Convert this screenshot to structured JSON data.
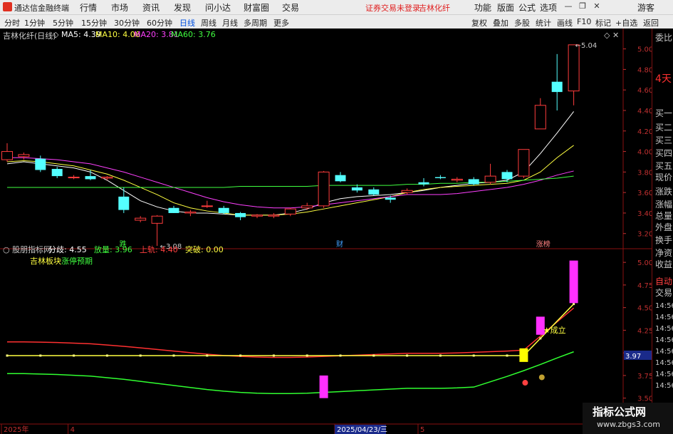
{
  "app": {
    "title": "通达信金融终端",
    "menus": [
      "行情",
      "市场",
      "资讯",
      "发现",
      "问小达",
      "财富圈",
      "交易"
    ],
    "notice": "证券交易未登录",
    "stock_link": "吉林化纤",
    "right_menus": [
      "功能",
      "版面",
      "公式",
      "选项"
    ],
    "user": "游客",
    "window_buttons": [
      "—",
      "❐",
      "✕"
    ]
  },
  "toolbar": {
    "periods": [
      "分时",
      "1分钟",
      "5分钟",
      "15分钟",
      "30分钟",
      "60分钟",
      "日线",
      "周线",
      "月线",
      "多周期",
      "更多"
    ],
    "active_period": "日线",
    "tools": [
      "复权",
      "叠加",
      "多股",
      "统计",
      "画线",
      "F10",
      "标记",
      "+自选",
      "返回"
    ]
  },
  "main_info": {
    "stock": "吉林化纤(日线)",
    "ma": [
      {
        "label": "MA5: 4.39",
        "color": "#ffffff"
      },
      {
        "label": "MA10: 4.06",
        "color": "#ffff40"
      },
      {
        "label": "MA20: 3.81",
        "color": "#ff40ff"
      },
      {
        "label": "MA60: 3.76",
        "color": "#40ff40"
      }
    ]
  },
  "side_panel": {
    "items": [
      "委比",
      "4天",
      "买一",
      "买二",
      "买三",
      "买四",
      "买五",
      "现价",
      "涨跌",
      "涨幅",
      "总量",
      "外盘",
      "换手",
      "净资",
      "收益",
      "自动",
      "交易",
      "14:56",
      "14:56",
      "14:56",
      "14:56",
      "14:56",
      "14:56",
      "14:56",
      "14:56"
    ],
    "tag": "0\nR\n1000"
  },
  "chart_data": {
    "type": "candlestick",
    "price_axis": {
      "ticks": [
        "5.00",
        "4.80",
        "4.60",
        "4.40",
        "4.20",
        "4.00",
        "3.80",
        "3.60",
        "3.40",
        "3.20"
      ],
      "range": [
        3.08,
        5.06
      ]
    },
    "candles": [
      {
        "o": 3.92,
        "h": 4.08,
        "l": 3.9,
        "c": 4.0
      },
      {
        "o": 3.95,
        "h": 3.99,
        "l": 3.92,
        "c": 3.97
      },
      {
        "o": 3.93,
        "h": 3.96,
        "l": 3.8,
        "c": 3.82
      },
      {
        "o": 3.83,
        "h": 3.85,
        "l": 3.74,
        "c": 3.76
      },
      {
        "o": 3.75,
        "h": 3.77,
        "l": 3.73,
        "c": 3.75
      },
      {
        "o": 3.76,
        "h": 3.82,
        "l": 3.72,
        "c": 3.73
      },
      {
        "o": 3.74,
        "h": 3.76,
        "l": 3.72,
        "c": 3.75
      },
      {
        "o": 3.56,
        "h": 3.65,
        "l": 3.4,
        "c": 3.43
      },
      {
        "o": 3.33,
        "h": 3.37,
        "l": 3.31,
        "c": 3.35
      },
      {
        "o": 3.3,
        "h": 3.38,
        "l": 3.08,
        "c": 3.37
      },
      {
        "o": 3.45,
        "h": 3.47,
        "l": 3.4,
        "c": 3.4
      },
      {
        "o": 3.4,
        "h": 3.43,
        "l": 3.37,
        "c": 3.41
      },
      {
        "o": 3.47,
        "h": 3.52,
        "l": 3.45,
        "c": 3.47
      },
      {
        "o": 3.45,
        "h": 3.47,
        "l": 3.39,
        "c": 3.4
      },
      {
        "o": 3.4,
        "h": 3.41,
        "l": 3.33,
        "c": 3.36
      },
      {
        "o": 3.37,
        "h": 3.39,
        "l": 3.35,
        "c": 3.38
      },
      {
        "o": 3.37,
        "h": 3.4,
        "l": 3.35,
        "c": 3.38
      },
      {
        "o": 3.39,
        "h": 3.45,
        "l": 3.37,
        "c": 3.44
      },
      {
        "o": 3.45,
        "h": 3.5,
        "l": 3.43,
        "c": 3.47
      },
      {
        "o": 3.47,
        "h": 3.81,
        "l": 3.45,
        "c": 3.8
      },
      {
        "o": 3.77,
        "h": 3.8,
        "l": 3.7,
        "c": 3.71
      },
      {
        "o": 3.65,
        "h": 3.68,
        "l": 3.6,
        "c": 3.62
      },
      {
        "o": 3.63,
        "h": 3.65,
        "l": 3.57,
        "c": 3.58
      },
      {
        "o": 3.55,
        "h": 3.57,
        "l": 3.5,
        "c": 3.53
      },
      {
        "o": 3.6,
        "h": 3.64,
        "l": 3.58,
        "c": 3.62
      },
      {
        "o": 3.7,
        "h": 3.74,
        "l": 3.66,
        "c": 3.68
      },
      {
        "o": 3.75,
        "h": 3.77,
        "l": 3.73,
        "c": 3.74
      },
      {
        "o": 3.72,
        "h": 3.75,
        "l": 3.7,
        "c": 3.73
      },
      {
        "o": 3.73,
        "h": 3.75,
        "l": 3.67,
        "c": 3.68
      },
      {
        "o": 3.7,
        "h": 3.88,
        "l": 3.68,
        "c": 3.76
      },
      {
        "o": 3.8,
        "h": 3.82,
        "l": 3.7,
        "c": 3.73
      },
      {
        "o": 3.76,
        "h": 4.02,
        "l": 3.74,
        "c": 4.02
      },
      {
        "o": 4.22,
        "h": 4.52,
        "l": 4.22,
        "c": 4.45
      },
      {
        "o": 4.68,
        "h": 4.95,
        "l": 4.4,
        "c": 4.58
      },
      {
        "o": 4.59,
        "h": 5.04,
        "l": 4.45,
        "c": 5.04
      }
    ],
    "moving_averages": [
      {
        "name": "MA5",
        "color": "#ffffff",
        "values": [
          3.88,
          3.9,
          3.88,
          3.86,
          3.84,
          3.8,
          3.72,
          3.62,
          3.52,
          3.46,
          3.42,
          3.4,
          3.4,
          3.39,
          3.38,
          3.38,
          3.38,
          3.4,
          3.44,
          3.5,
          3.54,
          3.56,
          3.57,
          3.58,
          3.6,
          3.62,
          3.65,
          3.67,
          3.69,
          3.7,
          3.72,
          3.8,
          3.98,
          4.18,
          4.39
        ]
      },
      {
        "name": "MA10",
        "color": "#ffff40",
        "values": [
          3.9,
          3.91,
          3.9,
          3.88,
          3.86,
          3.82,
          3.78,
          3.72,
          3.65,
          3.58,
          3.5,
          3.45,
          3.42,
          3.4,
          3.38,
          3.38,
          3.38,
          3.39,
          3.41,
          3.44,
          3.47,
          3.5,
          3.53,
          3.56,
          3.6,
          3.63,
          3.65,
          3.66,
          3.67,
          3.68,
          3.69,
          3.72,
          3.8,
          3.94,
          4.06
        ]
      },
      {
        "name": "MA20",
        "color": "#ff40ff",
        "values": [
          3.94,
          3.94,
          3.93,
          3.92,
          3.9,
          3.88,
          3.84,
          3.8,
          3.75,
          3.7,
          3.65,
          3.6,
          3.55,
          3.51,
          3.48,
          3.46,
          3.45,
          3.45,
          3.46,
          3.48,
          3.5,
          3.52,
          3.54,
          3.56,
          3.58,
          3.58,
          3.58,
          3.59,
          3.61,
          3.63,
          3.65,
          3.68,
          3.72,
          3.77,
          3.81
        ]
      },
      {
        "name": "MA60",
        "color": "#40ff40",
        "values": [
          3.65,
          3.65,
          3.65,
          3.65,
          3.65,
          3.65,
          3.65,
          3.65,
          3.65,
          3.65,
          3.65,
          3.65,
          3.65,
          3.65,
          3.66,
          3.66,
          3.66,
          3.66,
          3.66,
          3.67,
          3.67,
          3.67,
          3.67,
          3.67,
          3.68,
          3.68,
          3.69,
          3.69,
          3.7,
          3.7,
          3.71,
          3.72,
          3.73,
          3.74,
          3.76
        ]
      }
    ],
    "low_label": "3.08",
    "high_label": "5.04",
    "event_tags": [
      {
        "text": "跌",
        "index": 7,
        "color": "#40ff40"
      },
      {
        "text": "财",
        "index": 20,
        "color": "#40a0ff"
      },
      {
        "text": "涨榜",
        "index": 32,
        "color": "#ff8080"
      }
    ],
    "indicator": {
      "name": "股朋指标网",
      "values": [
        {
          "label": "分歧: 4.55",
          "color": "#ffffff"
        },
        {
          "label": "放量: 3.96",
          "color": "#40ff40"
        },
        {
          "label": "上轨: 4.40",
          "color": "#ff4040"
        },
        {
          "label": "突破: 0.00",
          "color": "#ffff40"
        }
      ],
      "subtitle": "吉林板块",
      "subtitle2": "涨停预期",
      "axis_ticks": [
        "5.00",
        "4.75",
        "4.50",
        "4.25",
        "4.00",
        "3.75",
        "3.50"
      ],
      "range": [
        3.45,
        5.08
      ],
      "current": "3.97",
      "bars": [
        {
          "index": 19,
          "low": 3.5,
          "high": 3.75,
          "color": "#ff30ff"
        },
        {
          "index": 31,
          "low": 3.9,
          "high": 4.05,
          "color": "#ffff00"
        },
        {
          "index": 32,
          "low": 4.2,
          "high": 4.4,
          "color": "#ff30ff"
        },
        {
          "index": 34,
          "low": 4.55,
          "high": 5.02,
          "color": "#ff30ff"
        }
      ],
      "divergence_label": "★成立"
    },
    "date_axis": [
      {
        "text": "2025年",
        "index": 0
      },
      {
        "text": "4",
        "index": 4
      },
      {
        "text": "2025/04/23/三",
        "index": 20
      },
      {
        "text": "5",
        "index": 25
      }
    ]
  },
  "watermark": {
    "line1": "指标公式网",
    "line2": "www.zbgs3.com"
  }
}
